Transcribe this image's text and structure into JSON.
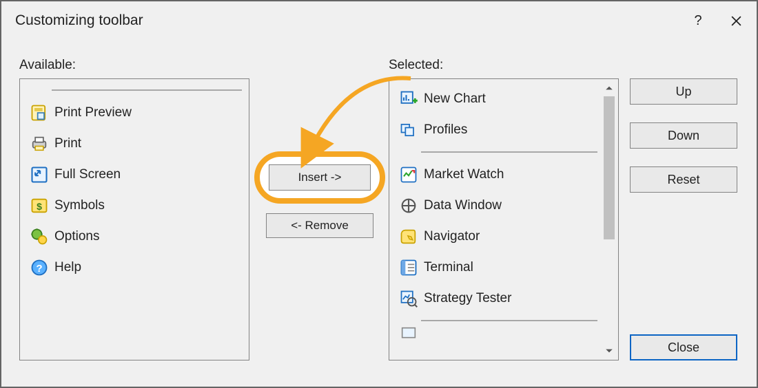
{
  "title": "Customizing toolbar",
  "labels": {
    "available": "Available:",
    "selected": "Selected:"
  },
  "buttons": {
    "insert": "Insert ->",
    "remove": "<- Remove",
    "up": "Up",
    "down": "Down",
    "reset": "Reset",
    "close": "Close",
    "help": "?"
  },
  "available_items": [
    {
      "label": "Print Preview",
      "icon": "print-preview-icon"
    },
    {
      "label": "Print",
      "icon": "print-icon"
    },
    {
      "label": "Full Screen",
      "icon": "full-screen-icon"
    },
    {
      "label": "Symbols",
      "icon": "symbols-icon"
    },
    {
      "label": "Options",
      "icon": "options-icon"
    },
    {
      "label": "Help",
      "icon": "help-icon"
    }
  ],
  "selected_items": [
    {
      "label": "New Chart",
      "icon": "new-chart-icon"
    },
    {
      "label": "Profiles",
      "icon": "profiles-icon"
    },
    {
      "label": "Market Watch",
      "icon": "market-watch-icon"
    },
    {
      "label": "Data Window",
      "icon": "data-window-icon"
    },
    {
      "label": "Navigator",
      "icon": "navigator-icon"
    },
    {
      "label": "Terminal",
      "icon": "terminal-icon"
    },
    {
      "label": "Strategy Tester",
      "icon": "strategy-tester-icon"
    }
  ]
}
